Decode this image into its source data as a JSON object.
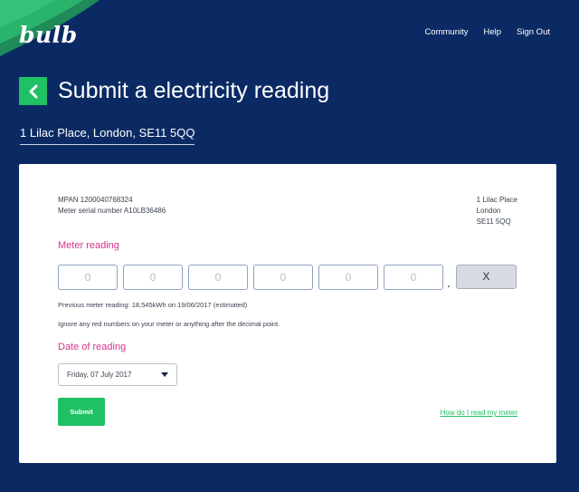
{
  "brand": {
    "logo_text": "bulb",
    "accent_color": "#20c064",
    "background_color": "#0b2a63",
    "highlight_color": "#d0348a"
  },
  "nav": {
    "items": [
      "Community",
      "Help",
      "Sign Out"
    ]
  },
  "header": {
    "back_icon": "chevron-left-icon",
    "title": "Submit a electricity reading",
    "address": "1 Lilac Place, London, SE11 5QQ"
  },
  "meter": {
    "mpan_line": "MPAN 1200040768324",
    "serial_line": "Meter serial number A10LB36486",
    "address_lines": [
      "1 Lilac Place",
      "London",
      "SE11 5QQ"
    ]
  },
  "reading": {
    "label": "Meter reading",
    "digit_placeholders": [
      "0",
      "0",
      "0",
      "0",
      "0",
      "0"
    ],
    "decimal_point": ".",
    "clear_label": "X",
    "previous_reading": "Previous meter reading: 18,545kWh on 19/06/2017 (estimated)",
    "instruction": "Ignore any red numbers on your meter or anything after the decimal point."
  },
  "date": {
    "label": "Date of reading",
    "selected": "Friday, 07 July 2017"
  },
  "actions": {
    "submit_label": "Submit",
    "help_link": "How do I read my meter"
  }
}
